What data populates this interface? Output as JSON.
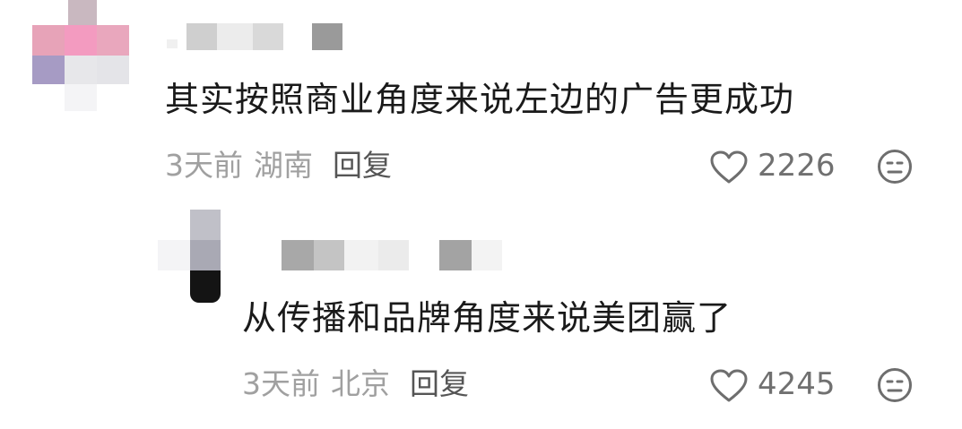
{
  "comments": [
    {
      "text": "其实按照商业角度来说左边的广告更成功",
      "time": "3天前",
      "location": "湖南",
      "reply_label": "回复",
      "likes": "2226",
      "like_icon": "heart-outline-icon",
      "react_icon": "neutral-face-icon"
    },
    {
      "text": "从传播和品牌角度来说美团赢了",
      "time": "3天前",
      "location": "北京",
      "reply_label": "回复",
      "likes": "4245",
      "like_icon": "heart-outline-icon",
      "react_icon": "neutral-face-icon"
    }
  ],
  "colors": {
    "text": "#1a1a1a",
    "meta": "#a0a0a0",
    "reply": "#555555",
    "icon": "#6e6e6e"
  }
}
